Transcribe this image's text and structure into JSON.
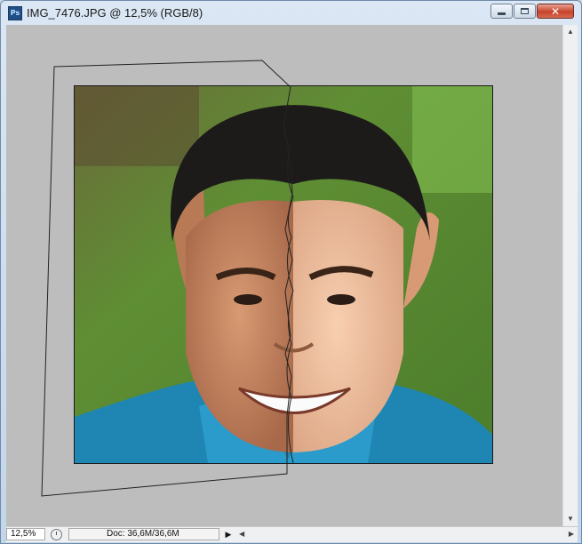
{
  "window": {
    "app_icon": "Ps",
    "title": "IMG_7476.JPG @ 12,5% (RGB/8)",
    "buttons": {
      "minimize": "minimize-icon",
      "maximize": "maximize-icon",
      "close": "✕"
    }
  },
  "status": {
    "zoom": "12,5%",
    "doc_info": "Doc: 36,6M/36,6M",
    "menu_arrow": "▶"
  },
  "scrollbars": {
    "up": "▲",
    "down": "▼",
    "left": "◀",
    "right": "▶"
  },
  "colors": {
    "canvas_bg": "#bdbdbd",
    "chrome": "#c9d8ea",
    "close": "#c7422b"
  }
}
